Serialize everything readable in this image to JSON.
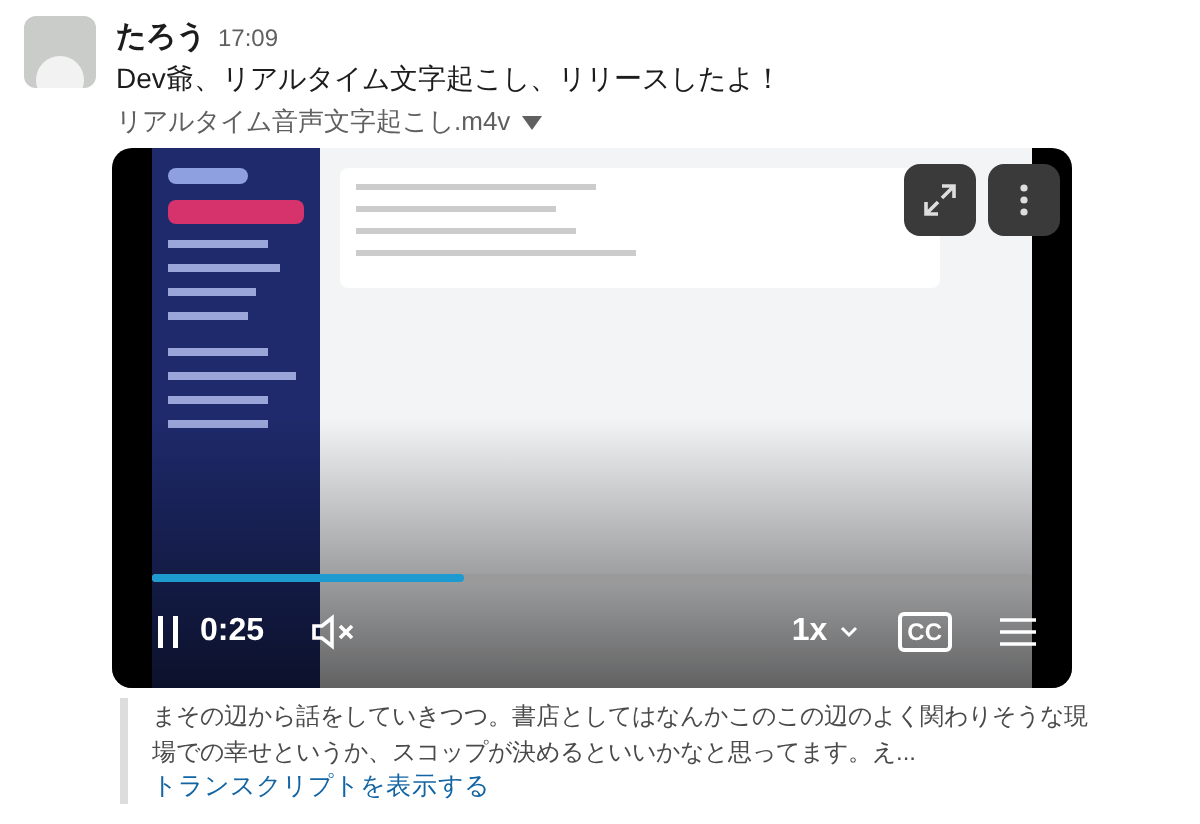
{
  "message": {
    "author": "たろう",
    "time": "17:09",
    "text": "Dev爺、リアルタイム文字起こし、リリースしたよ！"
  },
  "attachment": {
    "filename": "リアルタイム音声文字起こし.m4v",
    "expanded": true
  },
  "video": {
    "playing": true,
    "muted": true,
    "progress": {
      "level": 0.355
    },
    "time": "0:25",
    "speed": "1x",
    "captions": "CC"
  },
  "transcript": {
    "text": "まその辺から話をしていきつつ。書店としてはなんかこのこの辺のよく関わりそうな現場での幸せというか、スコップが決めるといいかなと思ってます。え...",
    "link": "トランスクリプトを表示する"
  }
}
